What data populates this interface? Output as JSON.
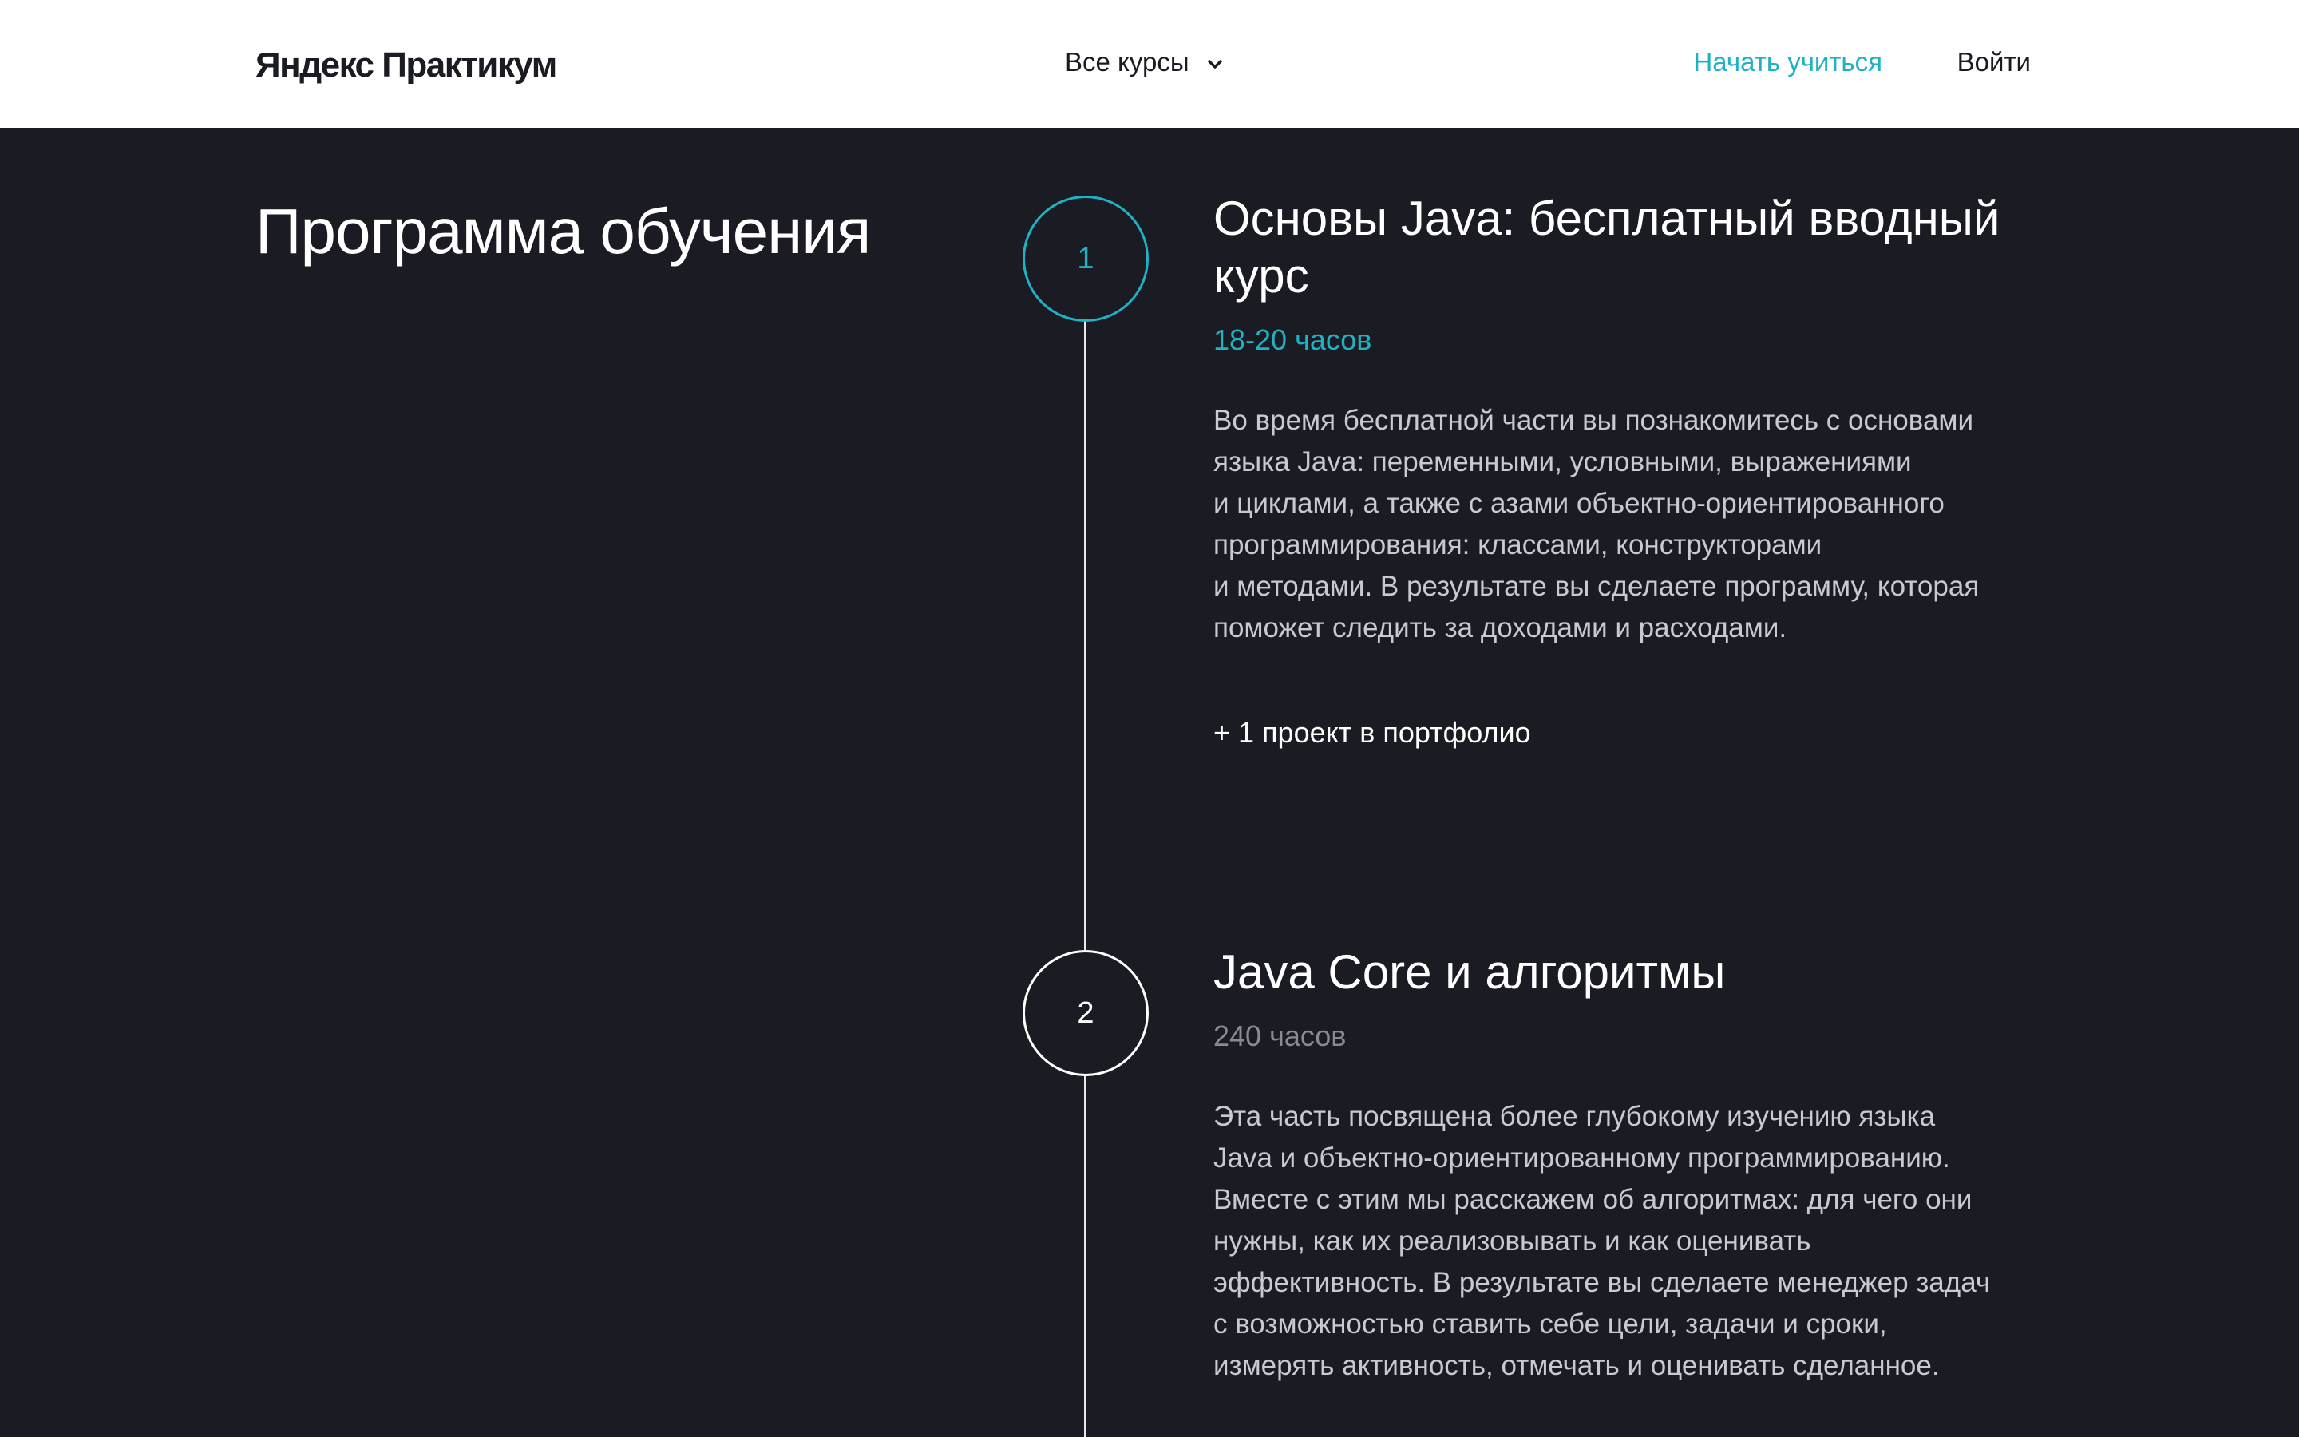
{
  "header": {
    "logo": "Яндекс Практикум",
    "courses_label": "Все курсы",
    "start_label": "Начать учиться",
    "login_label": "Войти"
  },
  "section": {
    "title": "Программа обучения"
  },
  "modules": [
    {
      "number": "1",
      "title": "Основы Java: бесплатный вводный курс",
      "hours": "18-20 часов",
      "description": "Во время бесплатной части вы познакомитесь с основами\nязыка Java: переменными, условными, выражениями\nи циклами, а также с азами объектно-ориентированного\nпрограммирования: классами, конструкторами\nи методами. В результате вы сделаете программу, которая\nпоможет следить за доходами и расходами.",
      "extra": "+ 1 проект в портфолио"
    },
    {
      "number": "2",
      "title": "Java Core и алгоритмы",
      "hours": "240 часов",
      "description": "Эта часть посвящена более глубокому изучению языка\nJava и объектно-ориентированному программированию.\nВместе с этим мы расскажем об алгоритмах: для чего они\nнужны, как их реализовывать и как оценивать\nэффективность. В результате вы сделаете менеджер задач\nс возможностью ставить себе цели, задачи и сроки,\nизмерять активность, отмечать и оценивать сделанное."
    }
  ],
  "colors": {
    "background": "#1b1c23",
    "accent": "#1fb1c4",
    "header_bg": "#ffffff"
  }
}
